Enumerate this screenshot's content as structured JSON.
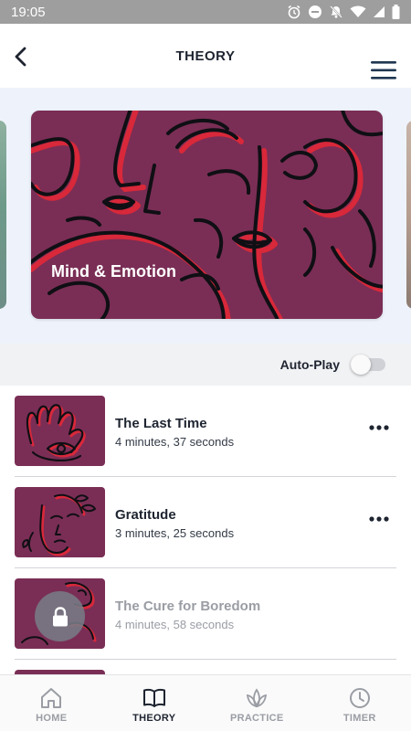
{
  "status_bar": {
    "time": "19:05"
  },
  "header": {
    "title": "THEORY"
  },
  "carousel": {
    "featured_title": "Mind & Emotion"
  },
  "autoplay": {
    "label": "Auto-Play",
    "enabled": false
  },
  "tracks": [
    {
      "title": "The Last Time",
      "duration": "4 minutes, 37 seconds",
      "locked": false
    },
    {
      "title": "Gratitude",
      "duration": "3 minutes, 25 seconds",
      "locked": false
    },
    {
      "title": "The Cure for Boredom",
      "duration": "4 minutes, 58 seconds",
      "locked": true
    }
  ],
  "tabs": [
    {
      "label": "HOME",
      "icon": "home-icon",
      "active": false
    },
    {
      "label": "THEORY",
      "icon": "book-icon",
      "active": true
    },
    {
      "label": "PRACTICE",
      "icon": "lotus-icon",
      "active": false
    },
    {
      "label": "TIMER",
      "icon": "clock-icon",
      "active": false
    }
  ],
  "colors": {
    "card_bg": "#7a2e55",
    "accent_red": "#d8283a",
    "text_dark": "#1e2430",
    "inactive": "#9a9da4"
  }
}
